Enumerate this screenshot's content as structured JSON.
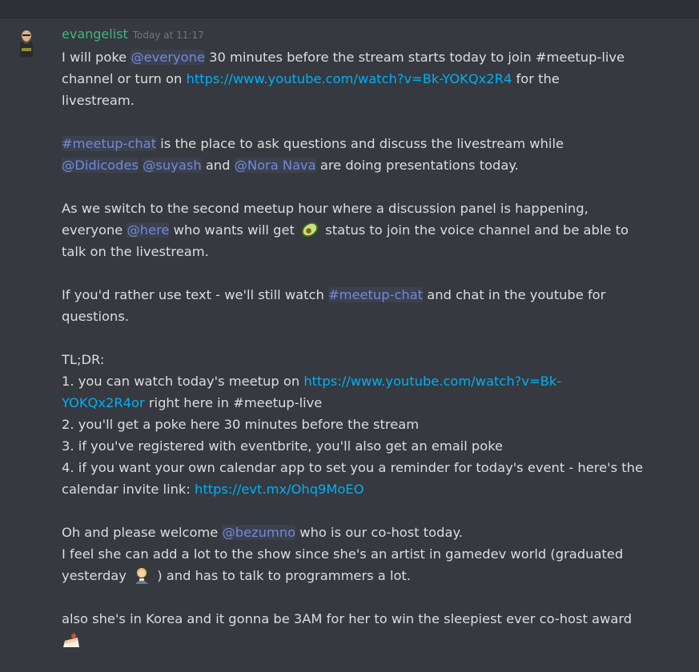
{
  "message": {
    "username": "evangelist",
    "timestamp": "Today at 11:17",
    "p1": {
      "t1": "I will poke ",
      "m1": "@everyone",
      "t2": " 30 minutes before the stream starts today to join #meetup-live",
      "t3": "channel or turn on ",
      "link1": "https://www.youtube.com/watch?v=Bk-YOKQx2R4",
      "t4": " for the",
      "t5": "livestream."
    },
    "p2": {
      "ch1": "#meetup-chat",
      "t1": " is the place to ask questions and discuss the livestream while",
      "m1": "@Didicodes",
      "m2": "@suyash",
      "t2": " and ",
      "m3": "@Nora Nava",
      "t3": " are doing presentations today."
    },
    "p3": {
      "t1": "As we switch to the second meetup hour where a discussion panel is happening,",
      "t2": "everyone ",
      "m1": "@here",
      "t3": " who wants will get ",
      "t4": " status to join the voice channel and be able to",
      "t5": "talk on the livestream."
    },
    "p4": {
      "t1": "If you'd rather use text - we'll still watch ",
      "ch1": "#meetup-chat",
      "t2": " and chat in the youtube for",
      "t3": "questions."
    },
    "p5": {
      "t1": "TL;DR:",
      "t2": "1. you can watch today's meetup on ",
      "link1a": "https://www.youtube.com/watch?v=Bk-",
      "link1b": "YOKQx2R4or",
      "t3": " right here in #meetup-live",
      "t4": "2. you'll get a poke here 30 minutes before the stream",
      "t5": "3. if you've registered with eventbrite, you'll also get an email poke",
      "t6": "4. if you want your own calendar app to set you a reminder for today's event - here's the",
      "t7": "calendar invite link: ",
      "link2": "https://evt.mx/Ohq9MoEO"
    },
    "p6": {
      "t1": "Oh and please welcome ",
      "m1": "@bezumno",
      "t2": " who is our co-host today.",
      "t3": "I feel she can add a lot to the show since she's an artist in gamedev world (graduated",
      "t4": "yesterday ",
      "t5": " ) and has to talk to programmers a lot."
    },
    "p7": {
      "t1": "also she's in Korea and it gonna be 3AM for her to win the sleepiest ever co-host award"
    },
    "emojis": [
      "avocado-emoji",
      "woman-student-emoji",
      "cake-emoji"
    ]
  },
  "colors": {
    "background": "#36393f",
    "text": "#dcddde",
    "username": "#43b581",
    "timestamp": "#72767d",
    "mention": "#7289da",
    "link": "#00b0f4"
  }
}
